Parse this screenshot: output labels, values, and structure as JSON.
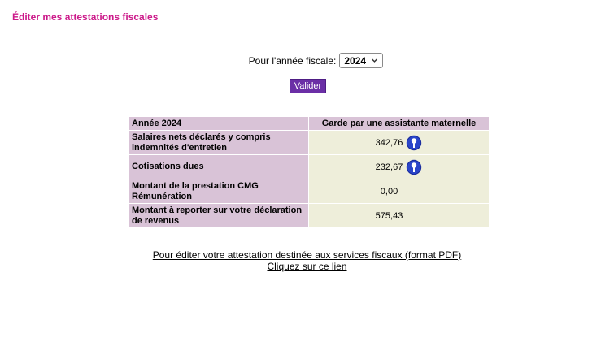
{
  "page": {
    "title": "Éditer mes attestations fiscales"
  },
  "form": {
    "year_label": "Pour l'année fiscale:",
    "year_value": "2024",
    "submit_label": "Valider"
  },
  "table": {
    "headers": [
      "Année 2024",
      "Garde par une assistante maternelle"
    ],
    "rows": [
      {
        "label": "Salaires nets déclarés  y compris indemnités d'entretien",
        "value": "342,76",
        "info_icon": true
      },
      {
        "label": "Cotisations dues",
        "value": "232,67",
        "info_icon": true
      },
      {
        "label": "Montant de la prestation CMG Rémunération",
        "value": "0,00",
        "info_icon": false
      },
      {
        "label": "Montant à reporter sur votre déclaration de revenus",
        "value": "575,43",
        "info_icon": false
      }
    ]
  },
  "links": {
    "pdf_link": "Pour éditer votre attestation destinée aux services fiscaux (format PDF)",
    "click_link": "Cliquez sur ce lien"
  },
  "colors": {
    "title": "#cc1a8a",
    "button": "#6b2fa6",
    "label_cell": "#d9c3d7",
    "value_cell": "#eeeeda",
    "info_icon": "#1b2ea0"
  },
  "icons": {
    "select_arrow": "chevron-down-icon",
    "row_info": "info-icon"
  }
}
